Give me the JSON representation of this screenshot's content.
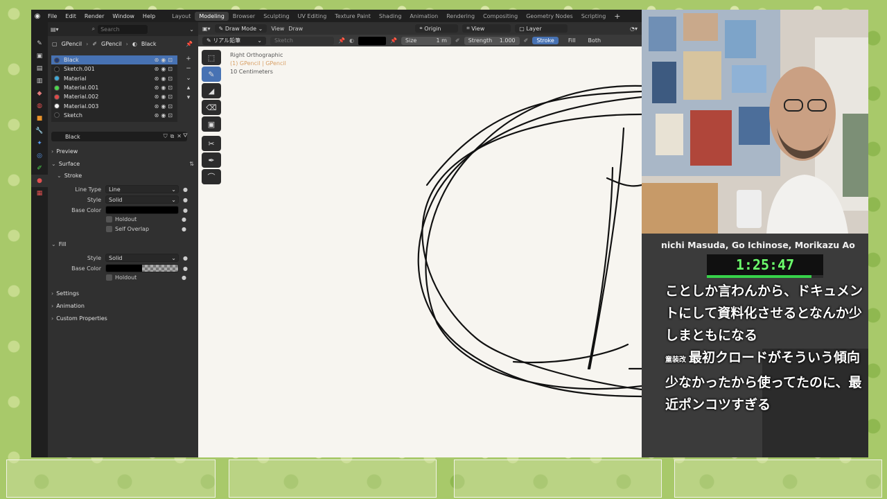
{
  "menubar": {
    "items": [
      "File",
      "Edit",
      "Render",
      "Window",
      "Help"
    ],
    "workspaces": [
      "Layout",
      "Modeling",
      "Browser",
      "Sculpting",
      "UV Editing",
      "Texture Paint",
      "Shading",
      "Animation",
      "Rendering",
      "Compositing",
      "Geometry Nodes",
      "Scripting"
    ],
    "active_workspace": "Modeling"
  },
  "properties": {
    "search_placeholder": "Search",
    "breadcrumb": [
      "GPencil",
      "GPencil",
      "Black"
    ],
    "materials": [
      {
        "name": "Black",
        "color": "#1e3a78",
        "selected": true
      },
      {
        "name": "Sketch.001",
        "color": "#1a1a1a",
        "selected": false
      },
      {
        "name": "Material",
        "color": "#3fa9d8",
        "selected": false
      },
      {
        "name": "Material.001",
        "color": "#4cd94c",
        "selected": false
      },
      {
        "name": "Material.002",
        "color": "#e04848",
        "selected": false
      },
      {
        "name": "Material.003",
        "color": "#f2f2f2",
        "selected": false
      },
      {
        "name": "Sketch",
        "color": "#202020",
        "selected": false
      }
    ],
    "material_name": "Black",
    "sections": {
      "preview": "Preview",
      "surface": "Surface",
      "stroke": "Stroke",
      "fill": "Fill",
      "settings": "Settings",
      "animation": "Animation",
      "custom_properties": "Custom Properties"
    },
    "stroke": {
      "line_type_label": "Line Type",
      "line_type": "Line",
      "style_label": "Style",
      "style": "Solid",
      "base_color_label": "Base Color",
      "holdout": "Holdout",
      "self_overlap": "Self Overlap"
    },
    "fill": {
      "style_label": "Style",
      "style": "Solid",
      "base_color_label": "Base Color",
      "holdout": "Holdout"
    }
  },
  "viewport": {
    "mode": "Draw Mode",
    "menus": [
      "View",
      "Draw"
    ],
    "origin": "Origin",
    "view": "View",
    "layer": "Layer",
    "brush": "リアル鉛筆",
    "material_field": "Sketch",
    "size_label": "Size",
    "size_value": "1 m",
    "strength_label": "Strength",
    "strength_value": "1.000",
    "stroke_tab": "Stroke",
    "fill_tab": "Fill",
    "both_tab": "Both",
    "info_view": "Right Orthographic",
    "info_object": "(1) GPencil | GPencil",
    "info_scale": "10 Centimeters"
  },
  "stream": {
    "names": "nichi Masuda, Go Ichinose, Morikazu Ao",
    "timer": "1:25:47",
    "timer_progress": 0.9,
    "chat_line1": "ことしか言わんから、ドキュメントにして資料化させるとなんか少しまともになる",
    "chat_user": "童装改",
    "chat_line2": "最初クロードがそういう傾向少なかったから使ってたのに、最近ポンコツすぎる"
  }
}
